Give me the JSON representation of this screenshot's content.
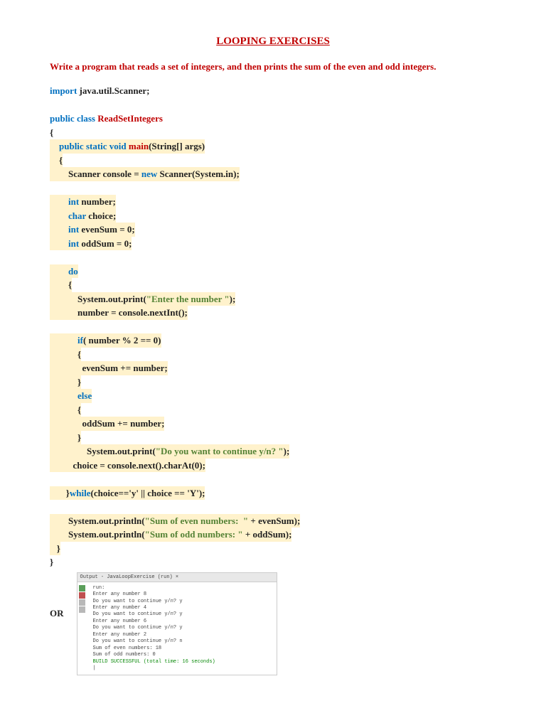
{
  "title": "LOOPING EXERCISES",
  "problem": "Write a program that reads a set of integers, and then prints the sum of the even and odd integers.",
  "kw": {
    "import": "import",
    "public": "public",
    "class": "class",
    "static": "static",
    "void": "void",
    "new": "new",
    "int": "int",
    "char": "char",
    "do": "do",
    "if": "if",
    "else": "else",
    "while": "while"
  },
  "ident": {
    "className": "ReadSetIntegers",
    "main": "main"
  },
  "code": {
    "importPkg": " java.util.Scanner;",
    "mainArgs": "(String[] args)",
    "scannerDecl": "        Scanner console = ",
    "scannerNew": " Scanner(System.in);",
    "number": " number;",
    "choice": " choice;",
    "evenSum": " evenSum = 0;",
    "oddSum": " oddSum = 0;",
    "print1a": "            System.out.print(",
    "print1b": ");",
    "readInt": "            number = console.nextInt();",
    "ifCond": "( number % 2 == 0)",
    "evenAdd": "              evenSum += number;",
    "oddAdd": "              oddSum += number;",
    "print2a": "                System.out.print(",
    "print2b": ");",
    "readChoice": "          choice = console.next().charAt(0);",
    "whileCond": "(choice=='y' || choice == 'Y');",
    "println1a": "        System.out.println(",
    "println1b": " + evenSum);",
    "println2a": "        System.out.println(",
    "println2b": " + oddSum);"
  },
  "str": {
    "enterNum": "\"Enter the number \"",
    "cont": "\"Do you want to continue y/n? \"",
    "sumEven": "\"Sum of even numbers:  \"",
    "sumOdd": "\"Sum of odd numbers: \""
  },
  "braces": {
    "open": "{",
    "close": "}",
    "closeWhile": "}"
  },
  "or": "OR",
  "output": {
    "header": "Output - JavaLoopExercise (run)  ×",
    "lines": [
      "run:",
      "Enter any number 8",
      "Do you want to continue y/n? y",
      "Enter any number 4",
      "Do you want to continue y/n? y",
      "Enter any number 6",
      "Do you want to continue y/n? y",
      "Enter any number 2",
      "Do you want to continue y/n? n",
      "Sum of even numbers: 18",
      "Sum of odd numbers: 0"
    ],
    "build": "BUILD SUCCESSFUL (total time: 16 seconds)"
  }
}
